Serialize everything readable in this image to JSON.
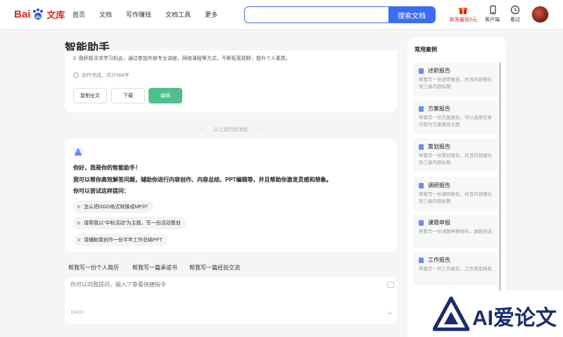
{
  "header": {
    "logo": {
      "bai": "Bai",
      "du": "du",
      "wenku": "文库"
    },
    "nav": [
      "首页",
      "文档",
      "写作赚钱",
      "文档工具",
      "更多"
    ],
    "search": {
      "value": "",
      "placeholder": "",
      "button": "搜索文档"
    },
    "icons": [
      {
        "label": "新客最低5元",
        "icon": "gift-icon"
      },
      {
        "label": "客户端",
        "icon": "phone-icon"
      },
      {
        "label": "看过",
        "icon": "clock-icon"
      }
    ]
  },
  "page_title": "智能助手",
  "history_card": {
    "cut_line": "2. 我积极寻求学习机会，通过参加外部专业讲座、网络课程等方式，不断拓宽视野，提升个人素质。",
    "done_text": "创作完成，共计684字",
    "buttons": {
      "copy": "复制全文",
      "download": "下载",
      "edit": "编辑"
    }
  },
  "divider_text": "以上是历史消息",
  "assistant": {
    "greeting": "你好，我是你的智能助手！",
    "intro": "我可以帮你高效解答问题，辅助你进行内容创作、内容总结、PPT编辑等，并且帮助你激发灵感和想象。",
    "try_prompt": "你可以尝试这样提问：",
    "suggestions": [
      "怎么把OGG格式转换成MP3?",
      "请帮我以“中秋活动”为主题，写一份活动策划",
      "请辅助我创作一份半年工作总结PPT"
    ]
  },
  "quick_prompts": [
    "帮我写一份个人简历",
    "帮我写一篇承诺书",
    "帮我写一篇经验交流"
  ],
  "input": {
    "placeholder": "你可以向我提问，输入\"/\"查看快捷指令",
    "counter": "0/400"
  },
  "cases": {
    "title": "常用案例",
    "items": [
      {
        "title": "述职报告",
        "desc": "帮我写一份述职报告，并且内容细化到三级内容标题"
      },
      {
        "title": "方案报告",
        "desc": "帮我写一份方案报告，可以选择任意内容为方案报告主题"
      },
      {
        "title": "策划报告",
        "desc": "帮我写一份策划报告，并且内容细化到三级内容标题"
      },
      {
        "title": "调研报告",
        "desc": "帮我写一份调研报告，并且内容细化到三级内容标题"
      },
      {
        "title": "课题申报",
        "desc": "帮我写一份课题申报材料，课题自选"
      },
      {
        "title": "工作报告",
        "desc": "帮我写一份工作报告，工作类型随机"
      }
    ]
  },
  "watermark": "AI爱论文",
  "colors": {
    "accent": "#3b6cf5",
    "green": "#4fbf8b",
    "brand_red": "#e1251b"
  }
}
